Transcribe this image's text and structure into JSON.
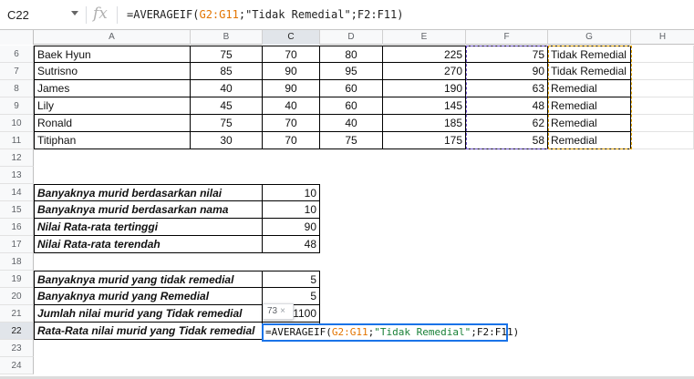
{
  "name_box": "C22",
  "fx_label": "fx",
  "formula": {
    "prefix": "=AVERAGEIF(",
    "range1": "G2:G11",
    "sep1": ";",
    "criteria": "\"Tidak Remedial\"",
    "sep2": ";",
    "range2": "F2:F11",
    "suffix": ")"
  },
  "columns": [
    "A",
    "B",
    "C",
    "D",
    "E",
    "F",
    "G",
    "H"
  ],
  "rows": [
    {
      "num": "6",
      "a": "Baek Hyun",
      "b": "75",
      "c": "70",
      "d": "80",
      "e": "225",
      "f": "75",
      "g": "Tidak Remedial"
    },
    {
      "num": "7",
      "a": "Sutrisno",
      "b": "85",
      "c": "90",
      "d": "95",
      "e": "270",
      "f": "90",
      "g": "Tidak Remedial"
    },
    {
      "num": "8",
      "a": "James",
      "b": "40",
      "c": "90",
      "d": "60",
      "e": "190",
      "f": "63",
      "g": "Remedial"
    },
    {
      "num": "9",
      "a": "Lily",
      "b": "45",
      "c": "40",
      "d": "60",
      "e": "145",
      "f": "48",
      "g": "Remedial"
    },
    {
      "num": "10",
      "a": "Ronald",
      "b": "75",
      "c": "70",
      "d": "40",
      "e": "185",
      "f": "62",
      "g": "Remedial"
    },
    {
      "num": "11",
      "a": "Titiphan",
      "b": "30",
      "c": "70",
      "d": "75",
      "e": "175",
      "f": "58",
      "g": "Remedial"
    }
  ],
  "summary1": [
    {
      "num": "14",
      "label": "Banyaknya murid berdasarkan nilai",
      "value": "10"
    },
    {
      "num": "15",
      "label": "Banyaknya murid berdasarkan nama",
      "value": "10"
    },
    {
      "num": "16",
      "label": "Nilai Rata-rata tertinggi",
      "value": "90"
    },
    {
      "num": "17",
      "label": "Nilai Rata-rata terendah",
      "value": "48"
    }
  ],
  "summary2": [
    {
      "num": "19",
      "label": "Banyaknya murid yang tidak remedial",
      "value": "5"
    },
    {
      "num": "20",
      "label": "Banyaknya murid yang Remedial",
      "value": "5"
    },
    {
      "num": "21",
      "label": "Jumlah nilai murid yang Tidak remedial",
      "value": "1100"
    },
    {
      "num": "22",
      "label": "Rata-Rata nilai murid yang Tidak remedial",
      "value": ""
    }
  ],
  "empty_rows": [
    "12",
    "13",
    "18",
    "23",
    "24"
  ],
  "tooltip": {
    "value": "73",
    "close": "×"
  }
}
